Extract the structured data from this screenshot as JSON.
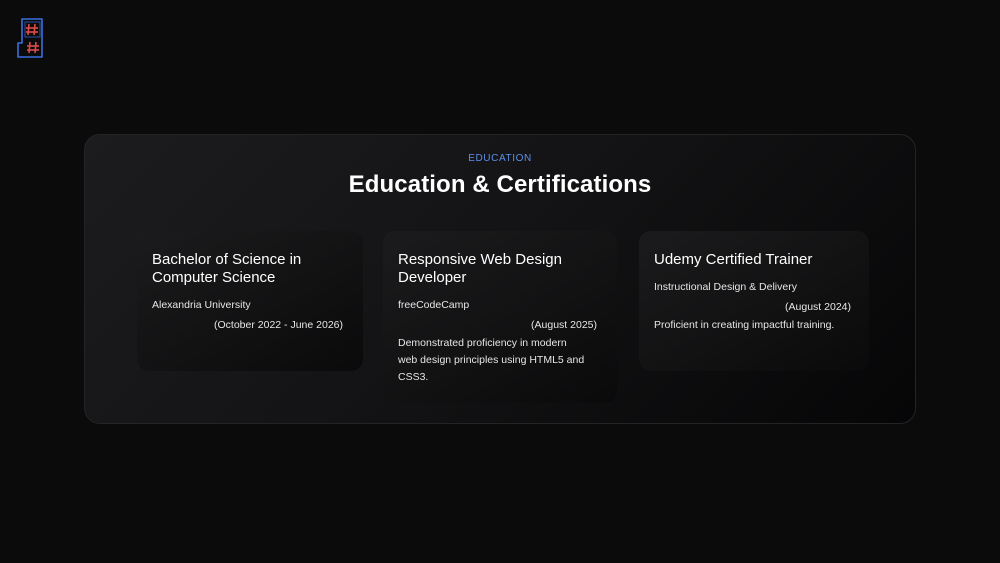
{
  "logo": {
    "icon": "hash-grid-logo-icon",
    "accent": "#e04a4a",
    "outline": "#3b6fe0"
  },
  "section": {
    "eyebrow": "EDUCATION",
    "title": "Education & Certifications",
    "eyebrow_color": "#5b8fe8"
  },
  "cards": [
    {
      "title": "Bachelor of Science in Computer Science",
      "issuer": "Alexandria University",
      "date": "(October 2022 - June 2026)",
      "description": ""
    },
    {
      "title": "Responsive Web Design Developer",
      "issuer": "freeCodeCamp",
      "date": "(August 2025)",
      "description": "Demonstrated proficiency in modern web design principles using HTML5 and CSS3."
    },
    {
      "title": "Udemy Certified Trainer",
      "issuer": "Instructional Design & Delivery",
      "date": "(August 2024)",
      "description": "Proficient in creating impactful training."
    }
  ]
}
